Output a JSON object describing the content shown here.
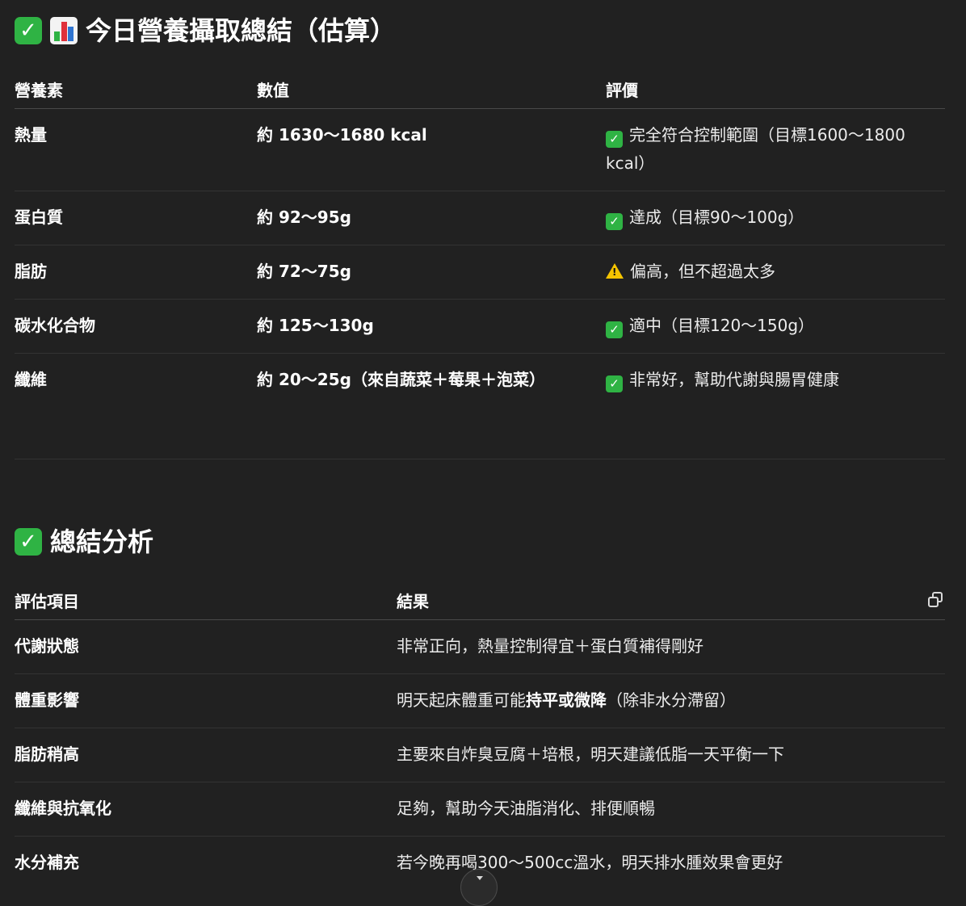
{
  "summary": {
    "title": "今日營養攝取總結（估算）",
    "headers": [
      "營養素",
      "數值",
      "評價"
    ],
    "rows": [
      {
        "nutrient": "熱量",
        "value": "約 1630～1680 kcal",
        "status": "check",
        "evaluation": "完全符合控制範圍（目標1600～1800 kcal）"
      },
      {
        "nutrient": "蛋白質",
        "value": "約 92～95g",
        "status": "check",
        "evaluation": "達成（目標90～100g）"
      },
      {
        "nutrient": "脂肪",
        "value": "約 72～75g",
        "status": "warning",
        "evaluation": "偏高，但不超過太多"
      },
      {
        "nutrient": "碳水化合物",
        "value": "約 125～130g",
        "status": "check",
        "evaluation": "適中（目標120～150g）"
      },
      {
        "nutrient": "纖維",
        "value": "約 20～25g（來自蔬菜＋莓果＋泡菜）",
        "status": "check",
        "evaluation": "非常好，幫助代謝與腸胃健康"
      }
    ]
  },
  "analysis": {
    "title": "總結分析",
    "headers": [
      "評估項目",
      "結果"
    ],
    "rows": [
      {
        "item": "代謝狀態",
        "result": "非常正向，熱量控制得宜＋蛋白質補得剛好"
      },
      {
        "item": "體重影響",
        "result_prefix": "明天起床體重可能",
        "result_emphasis": "持平或微降",
        "result_suffix": "（除非水分滯留）"
      },
      {
        "item": "脂肪稍高",
        "result": "主要來自炸臭豆腐＋培根，明天建議低脂一天平衡一下"
      },
      {
        "item": "纖維與抗氧化",
        "result": "足夠，幫助今天油脂消化、排便順暢"
      },
      {
        "item": "水分補充",
        "result": "若今晚再喝300～500cc溫水，明天排水腫效果會更好"
      }
    ]
  },
  "icons": {
    "check": "check-mark-button-icon",
    "chart": "bar-chart-icon",
    "warning": "warning-icon",
    "copy": "copy-icon",
    "scroll": "chevron-down-icon"
  },
  "colors": {
    "background": "#212121",
    "check_green": "#2fb344",
    "warning_yellow": "#f5c400"
  }
}
